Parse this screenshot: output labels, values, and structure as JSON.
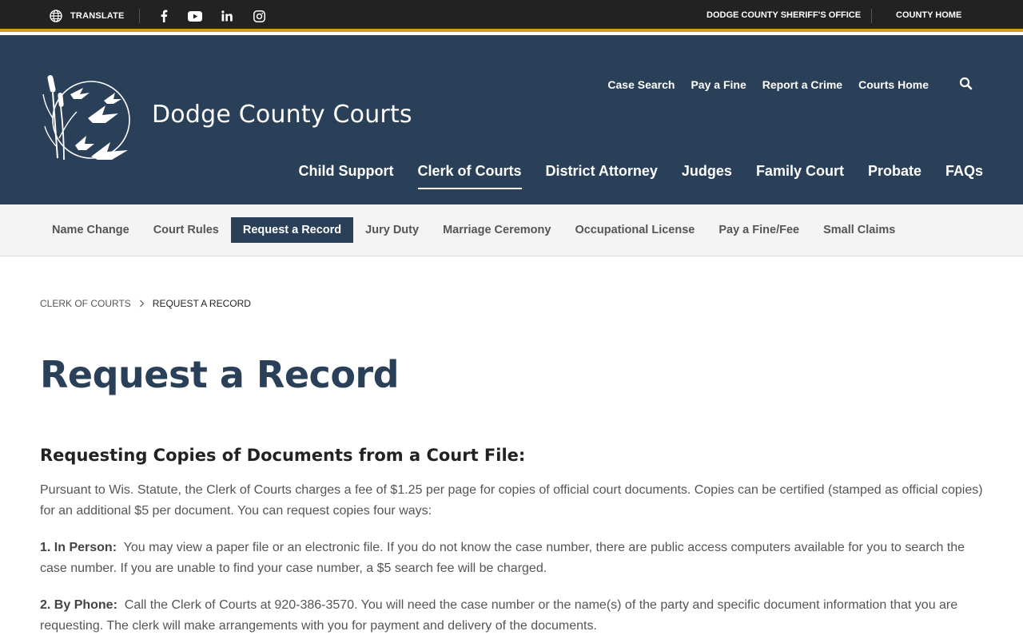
{
  "topbar": {
    "translate_label": "TRANSLATE",
    "social_icons": [
      "facebook-icon",
      "youtube-icon",
      "linkedin-icon",
      "instagram-icon"
    ],
    "sheriff_link": "DODGE COUNTY SHERIFF'S OFFICE",
    "county_home_link": "COUNTY HOME"
  },
  "header": {
    "site_title": "Dodge County Courts",
    "secondary_nav": [
      "Case Search",
      "Pay a Fine",
      "Report a Crime",
      "Courts Home"
    ],
    "main_nav": [
      "Child Support",
      "Clerk of Courts",
      "District Attorney",
      "Judges",
      "Family Court",
      "Probate",
      "FAQs"
    ],
    "active_main": "Clerk of Courts"
  },
  "subnav": {
    "items": [
      "Name Change",
      "Court Rules",
      "Request a Record",
      "Jury Duty",
      "Marriage Ceremony",
      "Occupational License",
      "Pay a Fine/Fee",
      "Small Claims"
    ],
    "active": "Request a Record"
  },
  "breadcrumb": {
    "parent": "CLERK OF COURTS",
    "current": "REQUEST A RECORD"
  },
  "content": {
    "page_title": "Request a Record",
    "section_heading": "Requesting Copies of Documents from a Court File:",
    "intro": "Pursuant to Wis. Statute, the Clerk of Courts charges a fee of $1.25 per page for copies of official court documents. Copies can be certified (stamped as official copies) for an additional $5 per document. You can request copies four ways:",
    "item1_label": "1.  In Person:",
    "item1_text": "You may view a paper file or an electronic file.  If you do not know the case number, there are public access computers available for you to search the case number. If you are unable to find your case number, a $5 search fee will be charged.",
    "item2_label": "2.  By Phone:",
    "item2_text": "Call the Clerk of Courts at 920-386-3570. You will need the case number or the name(s) of the party and specific document information that you are requesting. The clerk will make arrangements with you for payment and delivery of the documents."
  },
  "colors": {
    "header_bg": "#2a3f58",
    "topbar_bg": "#222222",
    "accent": "#d89a2b",
    "subnav_bg": "#f4f4f4"
  }
}
